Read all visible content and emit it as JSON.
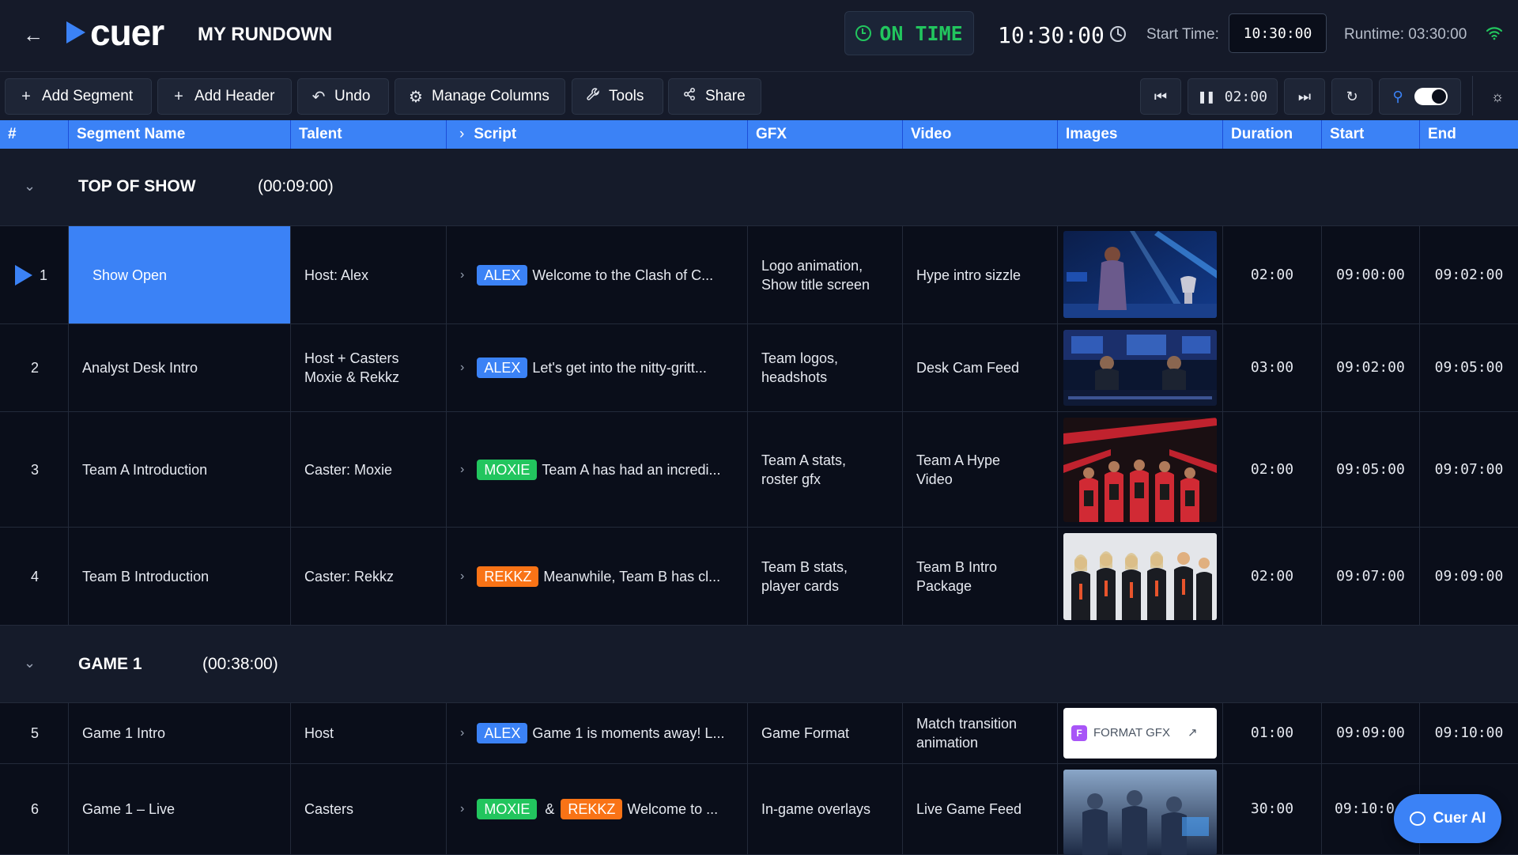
{
  "app": {
    "logo_text": "cuer",
    "rundown_title": "MY RUNDOWN"
  },
  "status": {
    "label": "ON TIME",
    "color": "#22c55e",
    "current_time": "10:30:00",
    "start_time_label": "Start Time:",
    "start_time_value": "10:30:00",
    "runtime": "Runtime: 03:30:00"
  },
  "toolbar": {
    "add_segment": "Add Segment",
    "add_header": "Add Header",
    "undo": "Undo",
    "manage_columns": "Manage Columns",
    "tools": "Tools",
    "share": "Share",
    "countdown": "02:00"
  },
  "columns": [
    "#",
    "Segment Name",
    "Talent",
    "Script",
    "GFX",
    "Video",
    "Images",
    "Duration",
    "Start",
    "End"
  ],
  "headers": [
    {
      "title": "TOP OF SHOW",
      "duration": "(00:09:00)"
    },
    {
      "title": "GAME 1",
      "duration": "(00:38:00)"
    }
  ],
  "rows": [
    {
      "num": "1",
      "name": "Show Open",
      "talent": [
        "Host: Alex"
      ],
      "tags": [
        {
          "label": "ALEX",
          "color": "blue"
        }
      ],
      "script": "Welcome to the Clash of C...",
      "gfx": [
        "Logo animation,",
        "Show title screen"
      ],
      "video": [
        "Hype intro sizzle"
      ],
      "image": "stage-host-trophy",
      "duration": "02:00",
      "start": "09:00:00",
      "end": "09:02:00",
      "current": true
    },
    {
      "num": "2",
      "name": "Analyst Desk Intro",
      "talent": [
        "Host + Casters",
        "Moxie & Rekkz"
      ],
      "tags": [
        {
          "label": "ALEX",
          "color": "blue"
        }
      ],
      "script": "Let's get into the nitty-gritt...",
      "gfx": [
        "Team logos,",
        "headshots"
      ],
      "video": [
        "Desk Cam Feed"
      ],
      "image": "analyst-desk",
      "duration": "03:00",
      "start": "09:02:00",
      "end": "09:05:00"
    },
    {
      "num": "3",
      "name": "Team A Introduction",
      "talent": [
        "Caster: Moxie"
      ],
      "tags": [
        {
          "label": "MOXIE",
          "color": "green"
        }
      ],
      "script": "Team A has had an incredi...",
      "gfx": [
        "Team A stats,",
        "roster gfx"
      ],
      "video": [
        "Team A Hype",
        "Video"
      ],
      "image": "team-a-red",
      "duration": "02:00",
      "start": "09:05:00",
      "end": "09:07:00"
    },
    {
      "num": "4",
      "name": "Team B Introduction",
      "talent": [
        "Caster: Rekkz"
      ],
      "tags": [
        {
          "label": "REKKZ",
          "color": "orange"
        }
      ],
      "script": "Meanwhile, Team B has cl...",
      "gfx": [
        "Team B stats,",
        "player cards"
      ],
      "video": [
        "Team B Intro",
        "Package"
      ],
      "image": "team-b-black",
      "duration": "02:00",
      "start": "09:07:00",
      "end": "09:09:00"
    },
    {
      "num": "5",
      "name": "Game 1 Intro",
      "talent": [
        "Host"
      ],
      "tags": [
        {
          "label": "ALEX",
          "color": "blue"
        }
      ],
      "script": "Game 1 is moments away! L...",
      "gfx": [
        "Game Format"
      ],
      "video": [
        "Match transition",
        "animation"
      ],
      "image_card": {
        "badge": "F",
        "label": "FORMAT GFX"
      },
      "duration": "01:00",
      "start": "09:09:00",
      "end": "09:10:00"
    },
    {
      "num": "6",
      "name": "Game 1 – Live",
      "talent": [
        "Casters"
      ],
      "tags": [
        {
          "label": "MOXIE",
          "color": "green"
        },
        {
          "label": "REKKZ",
          "color": "orange"
        }
      ],
      "tag_joiner": "&",
      "script": "Welcome to ...",
      "gfx": [
        "In-game overlays"
      ],
      "video": [
        "Live Game Feed"
      ],
      "image": "gaming-arena",
      "duration": "30:00",
      "start": "09:10:0",
      "end": ""
    }
  ],
  "assistant": {
    "label": "Cuer AI"
  }
}
